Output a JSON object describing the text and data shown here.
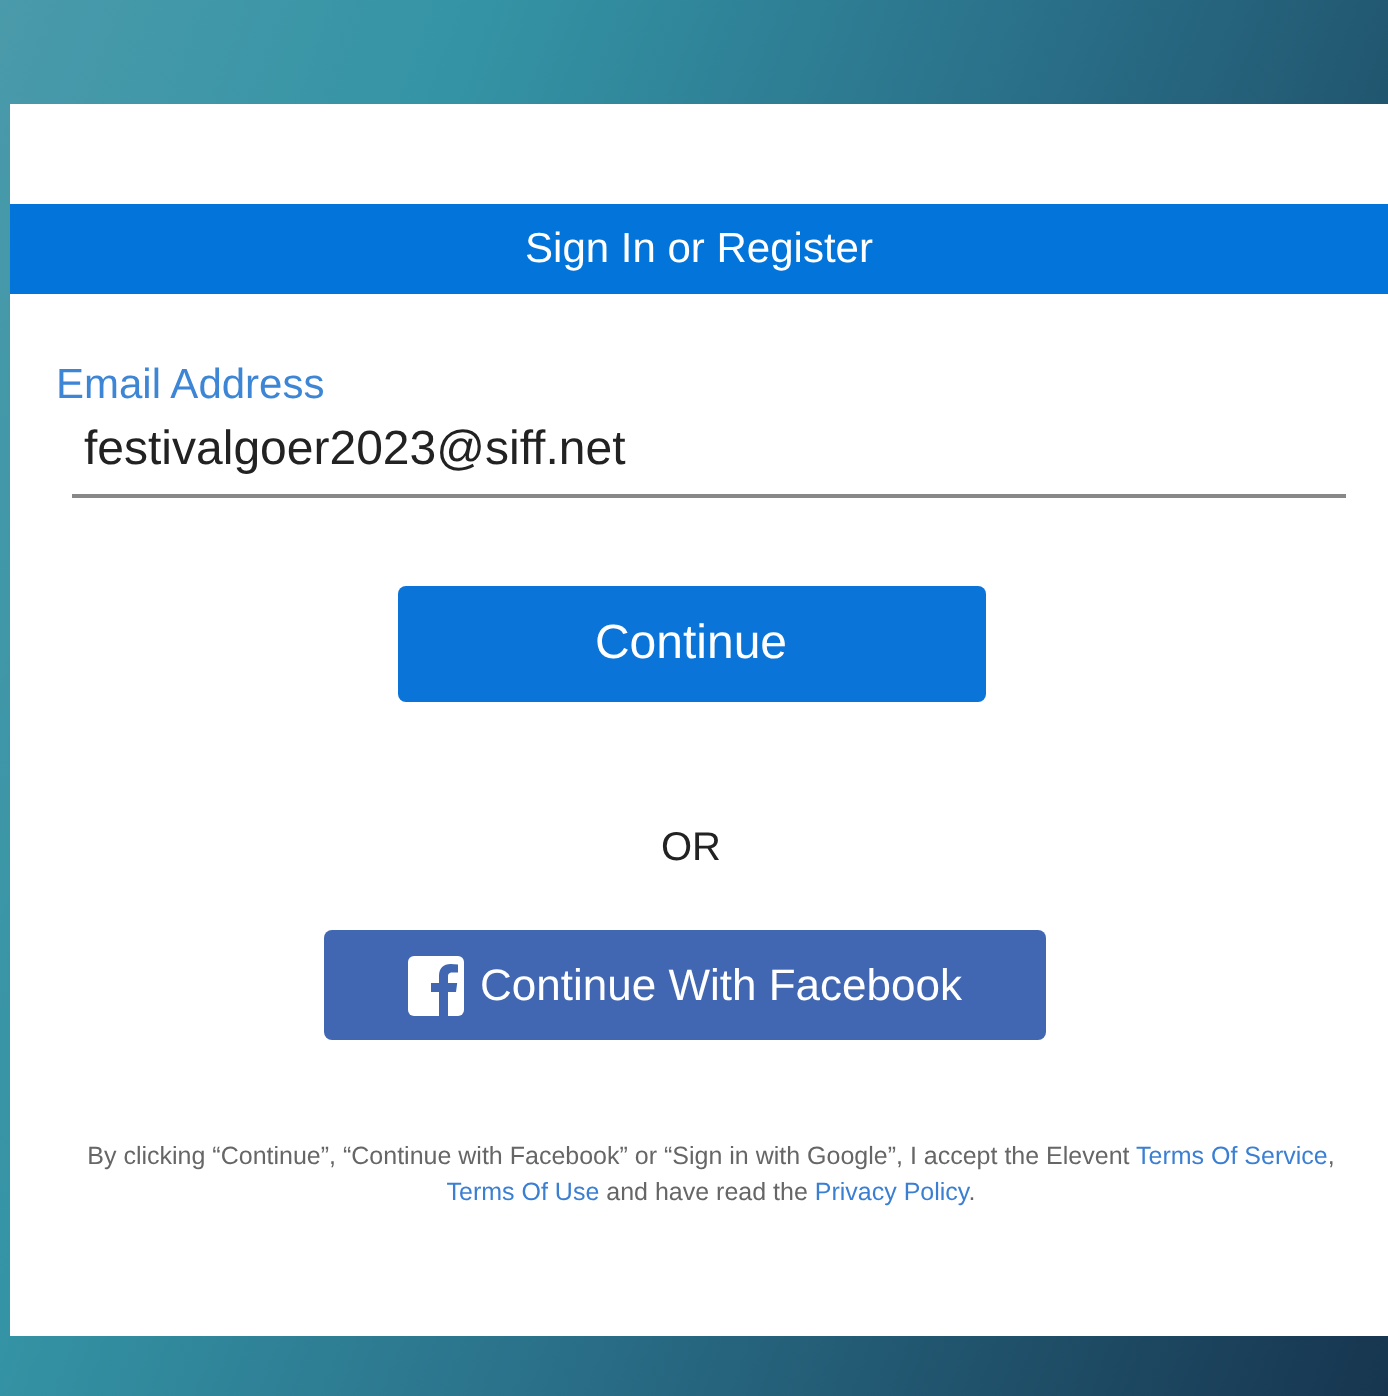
{
  "header": {
    "title": "Sign In or Register"
  },
  "email": {
    "label": "Email Address",
    "value": "festivalgoer2023@siff.net"
  },
  "continue_button": {
    "label": "Continue"
  },
  "divider": {
    "label": "OR"
  },
  "facebook_button": {
    "label": "Continue With Facebook"
  },
  "legal": [
    {
      "kind": "text",
      "text": "By clicking “Continue”, “Continue with Facebook” or “Sign in with Google”, I accept the Elevent "
    },
    {
      "kind": "link",
      "text": "Terms Of Service"
    },
    {
      "kind": "text",
      "text": ", "
    },
    {
      "kind": "link",
      "text": "Terms Of Use"
    },
    {
      "kind": "text",
      "text": " and have read the "
    },
    {
      "kind": "link",
      "text": "Privacy Policy"
    },
    {
      "kind": "text",
      "text": "."
    }
  ]
}
